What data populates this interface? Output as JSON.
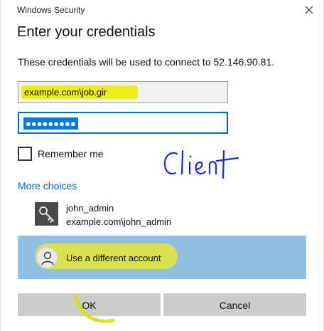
{
  "window": {
    "title": "Windows Security",
    "close_icon": "close-icon"
  },
  "dialog": {
    "heading": "Enter your credentials",
    "subtitle": "These credentials will be used to connect to 52.146.90.81."
  },
  "fields": {
    "username_value": "example.com\\job.gir",
    "password_masked": "●●●●●●●●●"
  },
  "remember": {
    "label": "Remember me",
    "checked": false
  },
  "annotation": {
    "handwriting": "Client",
    "highlight_color": "#ecee1a"
  },
  "more_choices": {
    "link_label": "More choices",
    "accounts": [
      {
        "name": "john_admin",
        "domain": "example.com\\john_admin",
        "icon": "key-icon"
      }
    ],
    "different_account_label": "Use a different account",
    "different_account_icon": "person-icon"
  },
  "buttons": {
    "ok_label": "OK",
    "cancel_label": "Cancel"
  },
  "colors": {
    "link": "#0067b8",
    "selected_row": "#90bfe6",
    "focus_border": "#0067c0",
    "button_bg": "#cccccc"
  }
}
